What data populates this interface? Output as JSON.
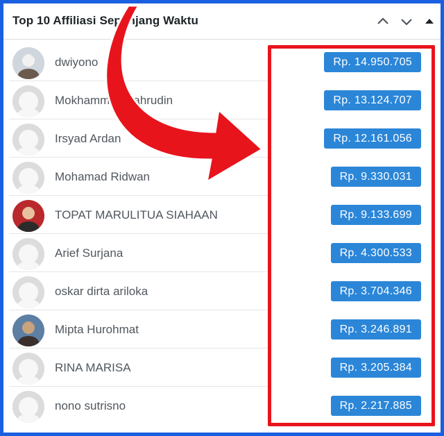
{
  "widget": {
    "title": "Top 10 Affiliasi Sepanjang Waktu",
    "icons": {
      "up": "chevron-up-icon",
      "down": "chevron-down-icon",
      "toggle": "triangle-toggle-icon"
    }
  },
  "affiliates": [
    {
      "name": "dwiyono",
      "amount": "Rp. 14.950.705",
      "avatar": "photo"
    },
    {
      "name": "Mokhammad Fahrudin",
      "amount": "Rp. 13.124.707",
      "avatar": "default"
    },
    {
      "name": "Irsyad Ardan",
      "amount": "Rp. 12.161.056",
      "avatar": "default"
    },
    {
      "name": "Mohamad Ridwan",
      "amount": "Rp. 9.330.031",
      "avatar": "default"
    },
    {
      "name": "TOPAT MARULITUA SIAHAAN",
      "amount": "Rp. 9.133.699",
      "avatar": "photo"
    },
    {
      "name": "Arief Surjana",
      "amount": "Rp. 4.300.533",
      "avatar": "default"
    },
    {
      "name": "oskar dirta ariloka",
      "amount": "Rp. 3.704.346",
      "avatar": "default"
    },
    {
      "name": "Mipta Hurohmat",
      "amount": "Rp. 3.246.891",
      "avatar": "photo"
    },
    {
      "name": "RINA MARISA",
      "amount": "Rp. 3.205.384",
      "avatar": "default"
    },
    {
      "name": "nono sutrisno",
      "amount": "Rp. 2.217.885",
      "avatar": "default"
    }
  ],
  "colors": {
    "badge": "#2b86d8",
    "highlight": "#e8141c",
    "arrow": "#e8141c",
    "frame": "#1a5fe0"
  }
}
